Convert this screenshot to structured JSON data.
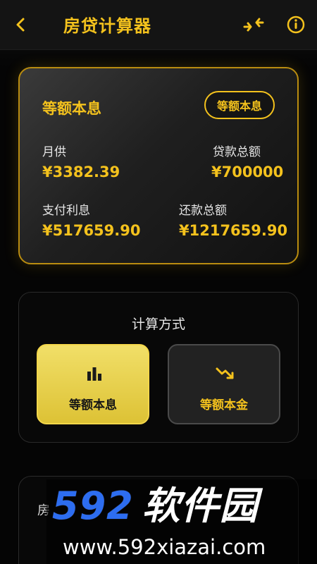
{
  "header": {
    "title": "房贷计算器",
    "icons": [
      "chevron-left-icon",
      "swap-icon",
      "info-icon"
    ]
  },
  "summary": {
    "title": "等额本息",
    "badge": "等额本息",
    "monthly": {
      "label": "月供",
      "value": "¥3382.39"
    },
    "loan_total": {
      "label": "贷款总额",
      "value": "¥700000"
    },
    "interest": {
      "label": "支付利息",
      "value": "¥517659.90"
    },
    "repayment_total": {
      "label": "还款总额",
      "value": "¥1217659.90"
    }
  },
  "method": {
    "title": "计算方式",
    "options": [
      {
        "label": "等额本息",
        "icon": "bar-chart-icon",
        "selected": true
      },
      {
        "label": "等额本金",
        "icon": "trend-down-icon",
        "selected": false
      }
    ]
  },
  "lower_card": {
    "label_fragment": "房"
  },
  "watermark": {
    "brand_number": "592",
    "brand_text": "软件园",
    "url": "www.592xiazai.com"
  },
  "colors": {
    "accent": "#f4c21d",
    "selected_option": "#ddc235",
    "background": "#050505",
    "watermark_blue": "#2d6df0"
  }
}
